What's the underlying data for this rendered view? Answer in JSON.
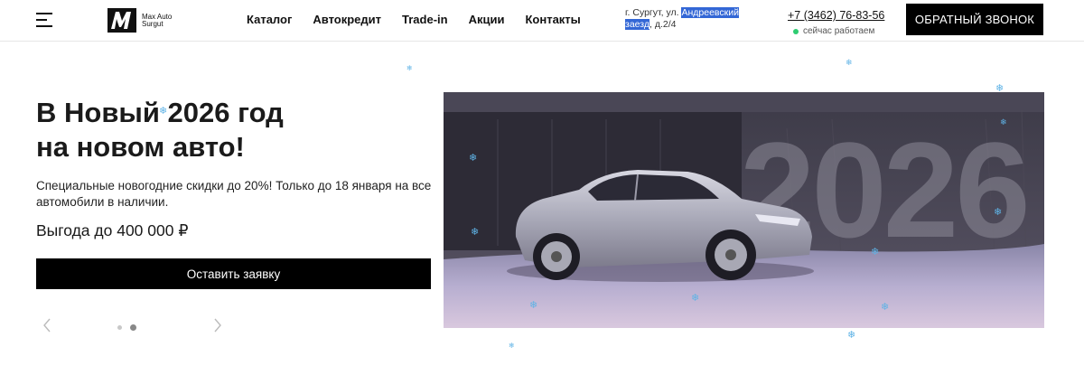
{
  "header": {
    "logo_text": "Max Auto Surgut",
    "nav": [
      "Каталог",
      "Автокредит",
      "Trade-in",
      "Акции",
      "Контакты"
    ],
    "address_prefix": "г. Сургут, ул. ",
    "address_highlight": "Андреевский заезд",
    "address_suffix": ", д.2/4",
    "phone": "+7 (3462) 76-83-56",
    "working_status": "сейчас работаем",
    "status_color": "#2ecc71",
    "callback_label": "ОБРАТНЫЙ ЗВОНОК"
  },
  "hero": {
    "title_line1": "В Новый 2026 год",
    "title_line2": "на новом авто!",
    "description": "Специальные новогодние скидки до 20%! Только до 18 января на все автомобили в наличии.",
    "benefit": "Выгода до 400 000 ₽",
    "cta_label": "Оставить заявку",
    "slides_total": 2,
    "slide_active": 2
  },
  "banner": {
    "year_text": "2026"
  },
  "icons": {
    "menu": "burger-menu-icon",
    "prev": "chevron-left-icon",
    "next": "chevron-right-icon",
    "flake": "snowflake-icon"
  },
  "colors": {
    "accent": "#000000",
    "selection": "#3367d6",
    "snow": "#5fb3e6"
  }
}
